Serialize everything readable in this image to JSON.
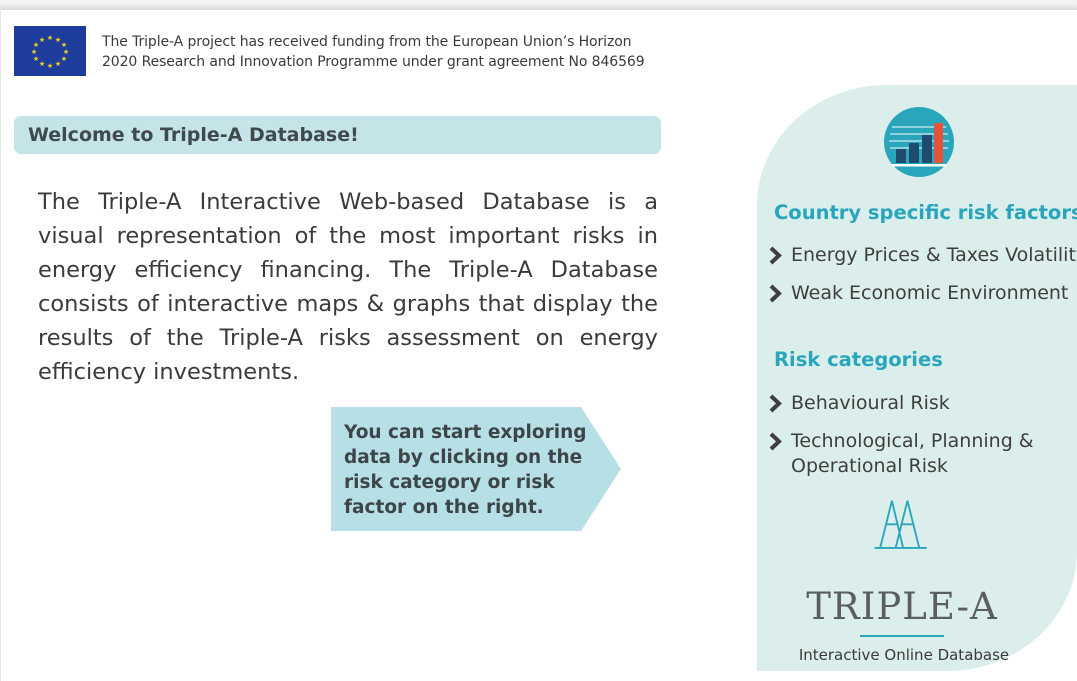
{
  "header": {
    "funding_line1": "The Triple-A project has received funding from the European Union’s Horizon",
    "funding_line2": "2020 Research and Innovation Programme under grant agreement No 846569"
  },
  "welcome": {
    "title": "Welcome to Triple-A Database!",
    "intro": "The Triple-A Interactive Web-based Database is a visual representation of the most important risks in energy efficiency financing. The Triple-A Database consists of interactive maps & graphs that  display the results of the Triple-A risks assessment on energy efficiency investments."
  },
  "callout": {
    "text": "You can start exploring data by clicking on the risk category or risk factor on the right."
  },
  "sidebar": {
    "country_title": "Country specific risk factors",
    "country_items": [
      {
        "label": "Energy Prices & Taxes Volatility"
      },
      {
        "label": "Weak Economic Environment"
      }
    ],
    "categories_title": "Risk categories",
    "category_items": [
      {
        "label": "Behavioural Risk"
      },
      {
        "label_line1": "Technological, Planning &",
        "label_line2": "Operational Risk"
      }
    ]
  },
  "logo": {
    "wordmark": "TRIPLE-A",
    "subtitle": "Interactive Online Database"
  },
  "icons": {
    "eu_flag": "eu-flag-icon",
    "chart": "bar-chart-icon",
    "chevron": "chevron-right-icon"
  },
  "colors": {
    "accent": "#29a6bc",
    "panel_bg": "#dbeeec",
    "banner_bg": "#c5e4e8",
    "callout_bg": "#b7dfe6",
    "chart_bar_red": "#e5533a",
    "chart_bar_navy": "#1f4b6e"
  }
}
